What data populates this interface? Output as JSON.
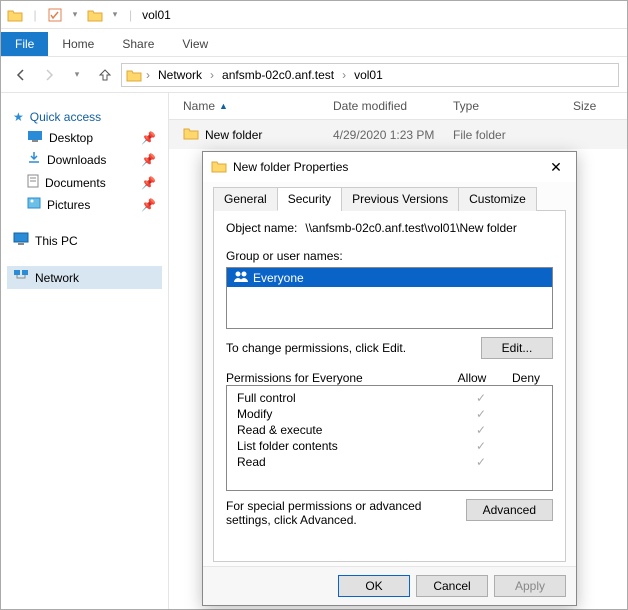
{
  "window": {
    "title": "vol01"
  },
  "ribbon": {
    "file": "File",
    "tabs": [
      "Home",
      "Share",
      "View"
    ]
  },
  "breadcrumb": [
    "Network",
    "anfsmb-02c0.anf.test",
    "vol01"
  ],
  "sidebar": {
    "quick_access": {
      "label": "Quick access",
      "items": [
        {
          "label": "Desktop",
          "icon": "desktop"
        },
        {
          "label": "Downloads",
          "icon": "downloads"
        },
        {
          "label": "Documents",
          "icon": "documents"
        },
        {
          "label": "Pictures",
          "icon": "pictures"
        }
      ]
    },
    "this_pc": {
      "label": "This PC"
    },
    "network": {
      "label": "Network"
    }
  },
  "columns": [
    "Name",
    "Date modified",
    "Type",
    "Size"
  ],
  "rows": [
    {
      "name": "New folder",
      "date": "4/29/2020 1:23 PM",
      "type": "File folder"
    }
  ],
  "dialog": {
    "title": "New folder Properties",
    "tabs": [
      "General",
      "Security",
      "Previous Versions",
      "Customize"
    ],
    "active_tab": 1,
    "object_label": "Object name:",
    "object_value": "\\\\anfsmb-02c0.anf.test\\vol01\\New folder",
    "group_label": "Group or user names:",
    "groups": [
      "Everyone"
    ],
    "edit_hint": "To change permissions, click Edit.",
    "edit_btn": "Edit...",
    "perm_header": "Permissions for Everyone",
    "allow": "Allow",
    "deny": "Deny",
    "permissions": [
      {
        "name": "Full control",
        "allow": true,
        "deny": false
      },
      {
        "name": "Modify",
        "allow": true,
        "deny": false
      },
      {
        "name": "Read & execute",
        "allow": true,
        "deny": false
      },
      {
        "name": "List folder contents",
        "allow": true,
        "deny": false
      },
      {
        "name": "Read",
        "allow": true,
        "deny": false
      }
    ],
    "adv_hint": "For special permissions or advanced settings, click Advanced.",
    "adv_btn": "Advanced",
    "ok": "OK",
    "cancel": "Cancel",
    "apply": "Apply"
  },
  "colors": {
    "accent": "#1979ca",
    "selection": "#0a64c8"
  }
}
